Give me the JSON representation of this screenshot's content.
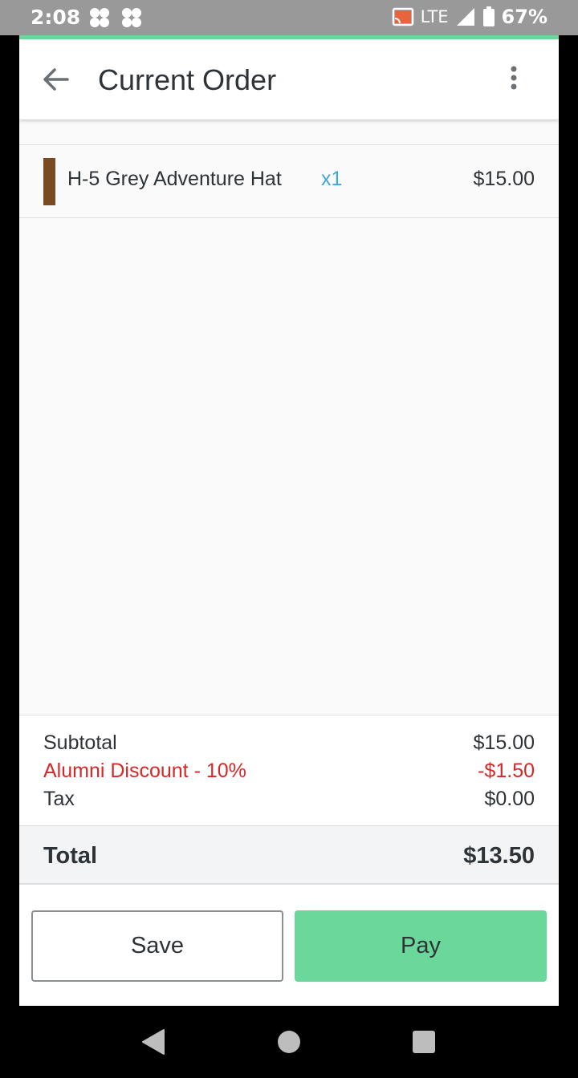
{
  "status_bar": {
    "time": "2:08",
    "network": "LTE",
    "battery": "67%",
    "icons": [
      "notification-icon",
      "notification-icon",
      "cast-icon",
      "signal-icon",
      "battery-icon"
    ]
  },
  "header": {
    "title": "Current Order",
    "back_icon": "arrow-left-icon",
    "menu_icon": "more-vert-icon"
  },
  "order": {
    "items": [
      {
        "name": "H-5 Grey Adventure Hat",
        "quantity": "x1",
        "price": "$15.00",
        "color": "#7a4a22"
      }
    ]
  },
  "summary": {
    "subtotal_label": "Subtotal",
    "subtotal_value": "$15.00",
    "discount_label": "Alumni Discount - 10%",
    "discount_value": "-$1.50",
    "tax_label": "Tax",
    "tax_value": "$0.00",
    "total_label": "Total",
    "total_value": "$13.50"
  },
  "actions": {
    "save_label": "Save",
    "pay_label": "Pay"
  },
  "colors": {
    "accent": "#6ad89b",
    "discount": "#d62828",
    "quantity": "#3fa9d8"
  }
}
